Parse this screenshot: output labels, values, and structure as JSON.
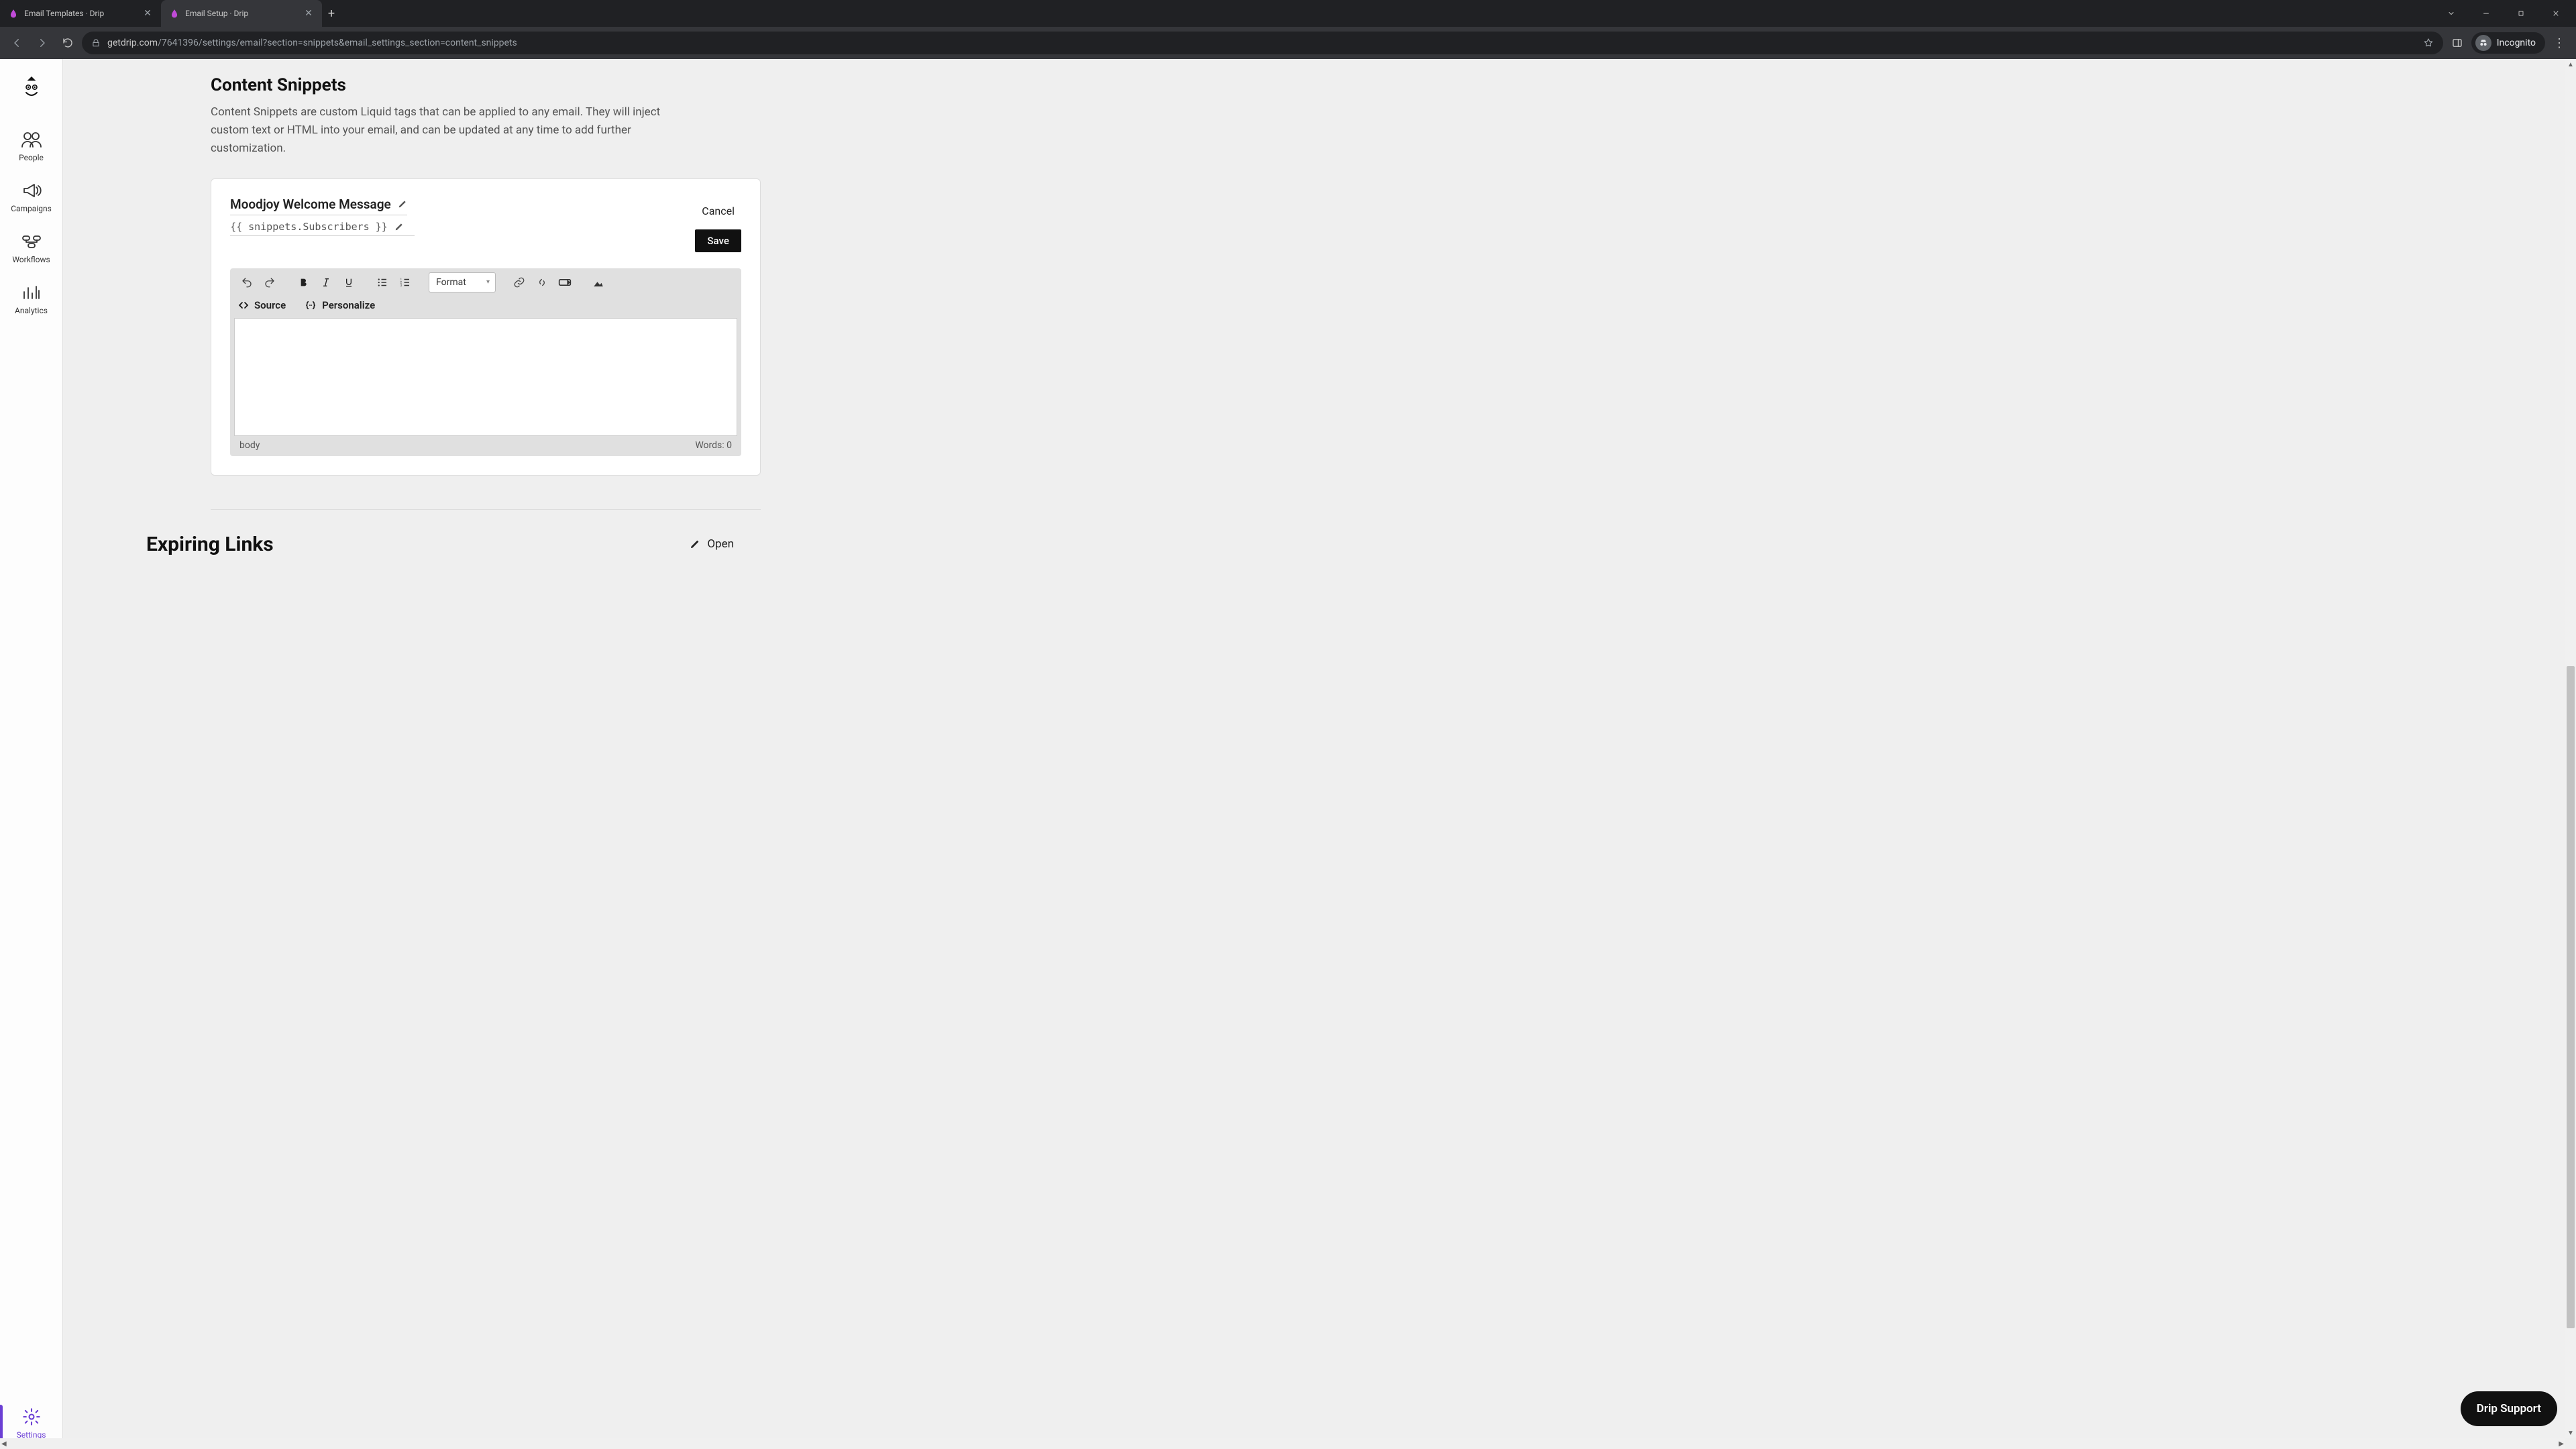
{
  "browser": {
    "tabs": [
      {
        "title": "Email Templates · Drip",
        "active": false
      },
      {
        "title": "Email Setup · Drip",
        "active": true
      }
    ],
    "url_host": "getdrip.com",
    "url_path": "/7641396/settings/email?section=snippets&email_settings_section=content_snippets",
    "incognito_label": "Incognito"
  },
  "sidebar": {
    "items": [
      {
        "label": "People",
        "icon": "people-icon"
      },
      {
        "label": "Campaigns",
        "icon": "megaphone-icon"
      },
      {
        "label": "Workflows",
        "icon": "workflow-icon"
      },
      {
        "label": "Analytics",
        "icon": "analytics-icon"
      },
      {
        "label": "Settings",
        "icon": "gear-icon",
        "active": true
      }
    ]
  },
  "content": {
    "section_title": "Content Snippets",
    "section_desc": "Content Snippets are custom Liquid tags that can be applied to any email. They will inject custom text or HTML into your email, and can be updated at any time to add further customization.",
    "snippet": {
      "name": "Moodjoy Welcome Message",
      "tag": "{{ snippets.Subscribers }}",
      "cancel_label": "Cancel",
      "save_label": "Save",
      "format_label": "Format",
      "source_label": "Source",
      "personalize_label": "Personalize",
      "footer_path": "body",
      "word_count_label": "Words: 0"
    },
    "expiring_title": "Expiring Links",
    "open_label": "Open"
  },
  "support_label": "Drip Support"
}
